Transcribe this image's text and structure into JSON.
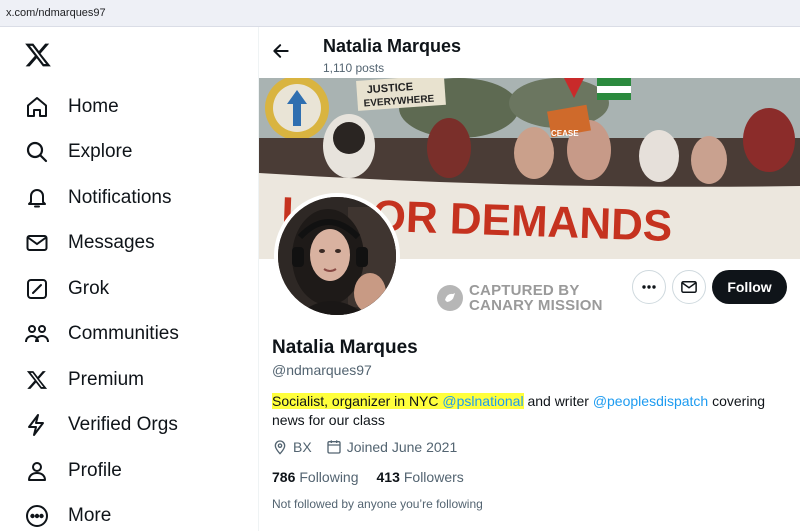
{
  "browser": {
    "url": "x.com/ndmarques97"
  },
  "sidebar": {
    "items": [
      {
        "label": "Home",
        "icon": "home-icon"
      },
      {
        "label": "Explore",
        "icon": "search-icon"
      },
      {
        "label": "Notifications",
        "icon": "bell-icon"
      },
      {
        "label": "Messages",
        "icon": "envelope-icon"
      },
      {
        "label": "Grok",
        "icon": "grok-icon"
      },
      {
        "label": "Communities",
        "icon": "people-icon"
      },
      {
        "label": "Premium",
        "icon": "x-logo-icon"
      },
      {
        "label": "Verified Orgs",
        "icon": "lightning-icon"
      },
      {
        "label": "Profile",
        "icon": "person-icon"
      },
      {
        "label": "More",
        "icon": "more-circle-icon"
      }
    ]
  },
  "header": {
    "name": "Natalia Marques",
    "posts": "1,110 posts"
  },
  "banner": {
    "sign_text_1": "JUSTICE",
    "sign_text_2": "EVERYWHERE",
    "banner_text": "LABOR DEMANDS",
    "small_sign": "CEASE"
  },
  "watermark": {
    "line1": "CAPTURED BY",
    "line2": "CANARY MISSION"
  },
  "actions": {
    "follow_label": "Follow"
  },
  "profile": {
    "name": "Natalia Marques",
    "handle": "@ndmarques97",
    "bio_highlight": "Socialist, organizer in NYC ",
    "bio_mention1": "@pslnational",
    "bio_middle": " and writer ",
    "bio_mention2": "@peoplesdispatch",
    "bio_end": " covering news for our class",
    "location": "BX",
    "joined": "Joined June 2021",
    "following_count": "786",
    "following_label": "Following",
    "followers_count": "413",
    "followers_label": "Followers",
    "not_followed": "Not followed by anyone you’re following"
  },
  "colors": {
    "accent": "#1d9bf0",
    "highlight": "#ffff3c",
    "text": "#0f1419",
    "muted": "#536471"
  }
}
